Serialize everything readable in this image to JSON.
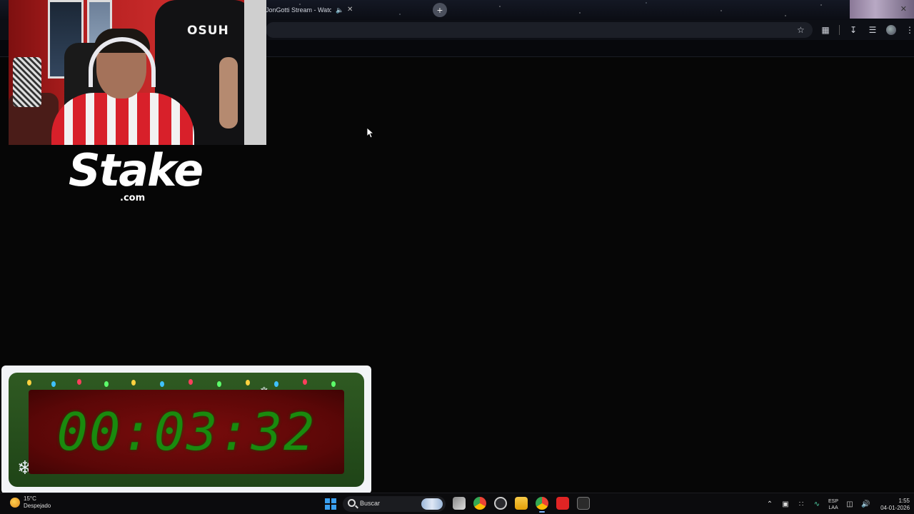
{
  "browser": {
    "tab_title": "JonGotti Stream - Watch L",
    "tab_mute_icon": "speaker-icon",
    "tab_close_icon": "close-icon",
    "new_tab_icon": "plus-icon"
  },
  "webcam": {
    "shirt_text": "OSUH"
  },
  "logo": {
    "word": "Stake",
    "suffix": ".com"
  },
  "countdown": {
    "time": "00:03:32",
    "digit_color": "#1a8a0e",
    "frame_color": "#7a0c0c"
  },
  "taskbar": {
    "weather_temp": "15°C",
    "weather_desc": "Despejado",
    "search_placeholder": "Buscar",
    "lang_top": "ESP",
    "lang_bottom": "LAA",
    "time": "1:55",
    "date": "04-01-2026"
  },
  "colors": {
    "accent_blue": "#3aa0f0",
    "background": "#060606"
  }
}
